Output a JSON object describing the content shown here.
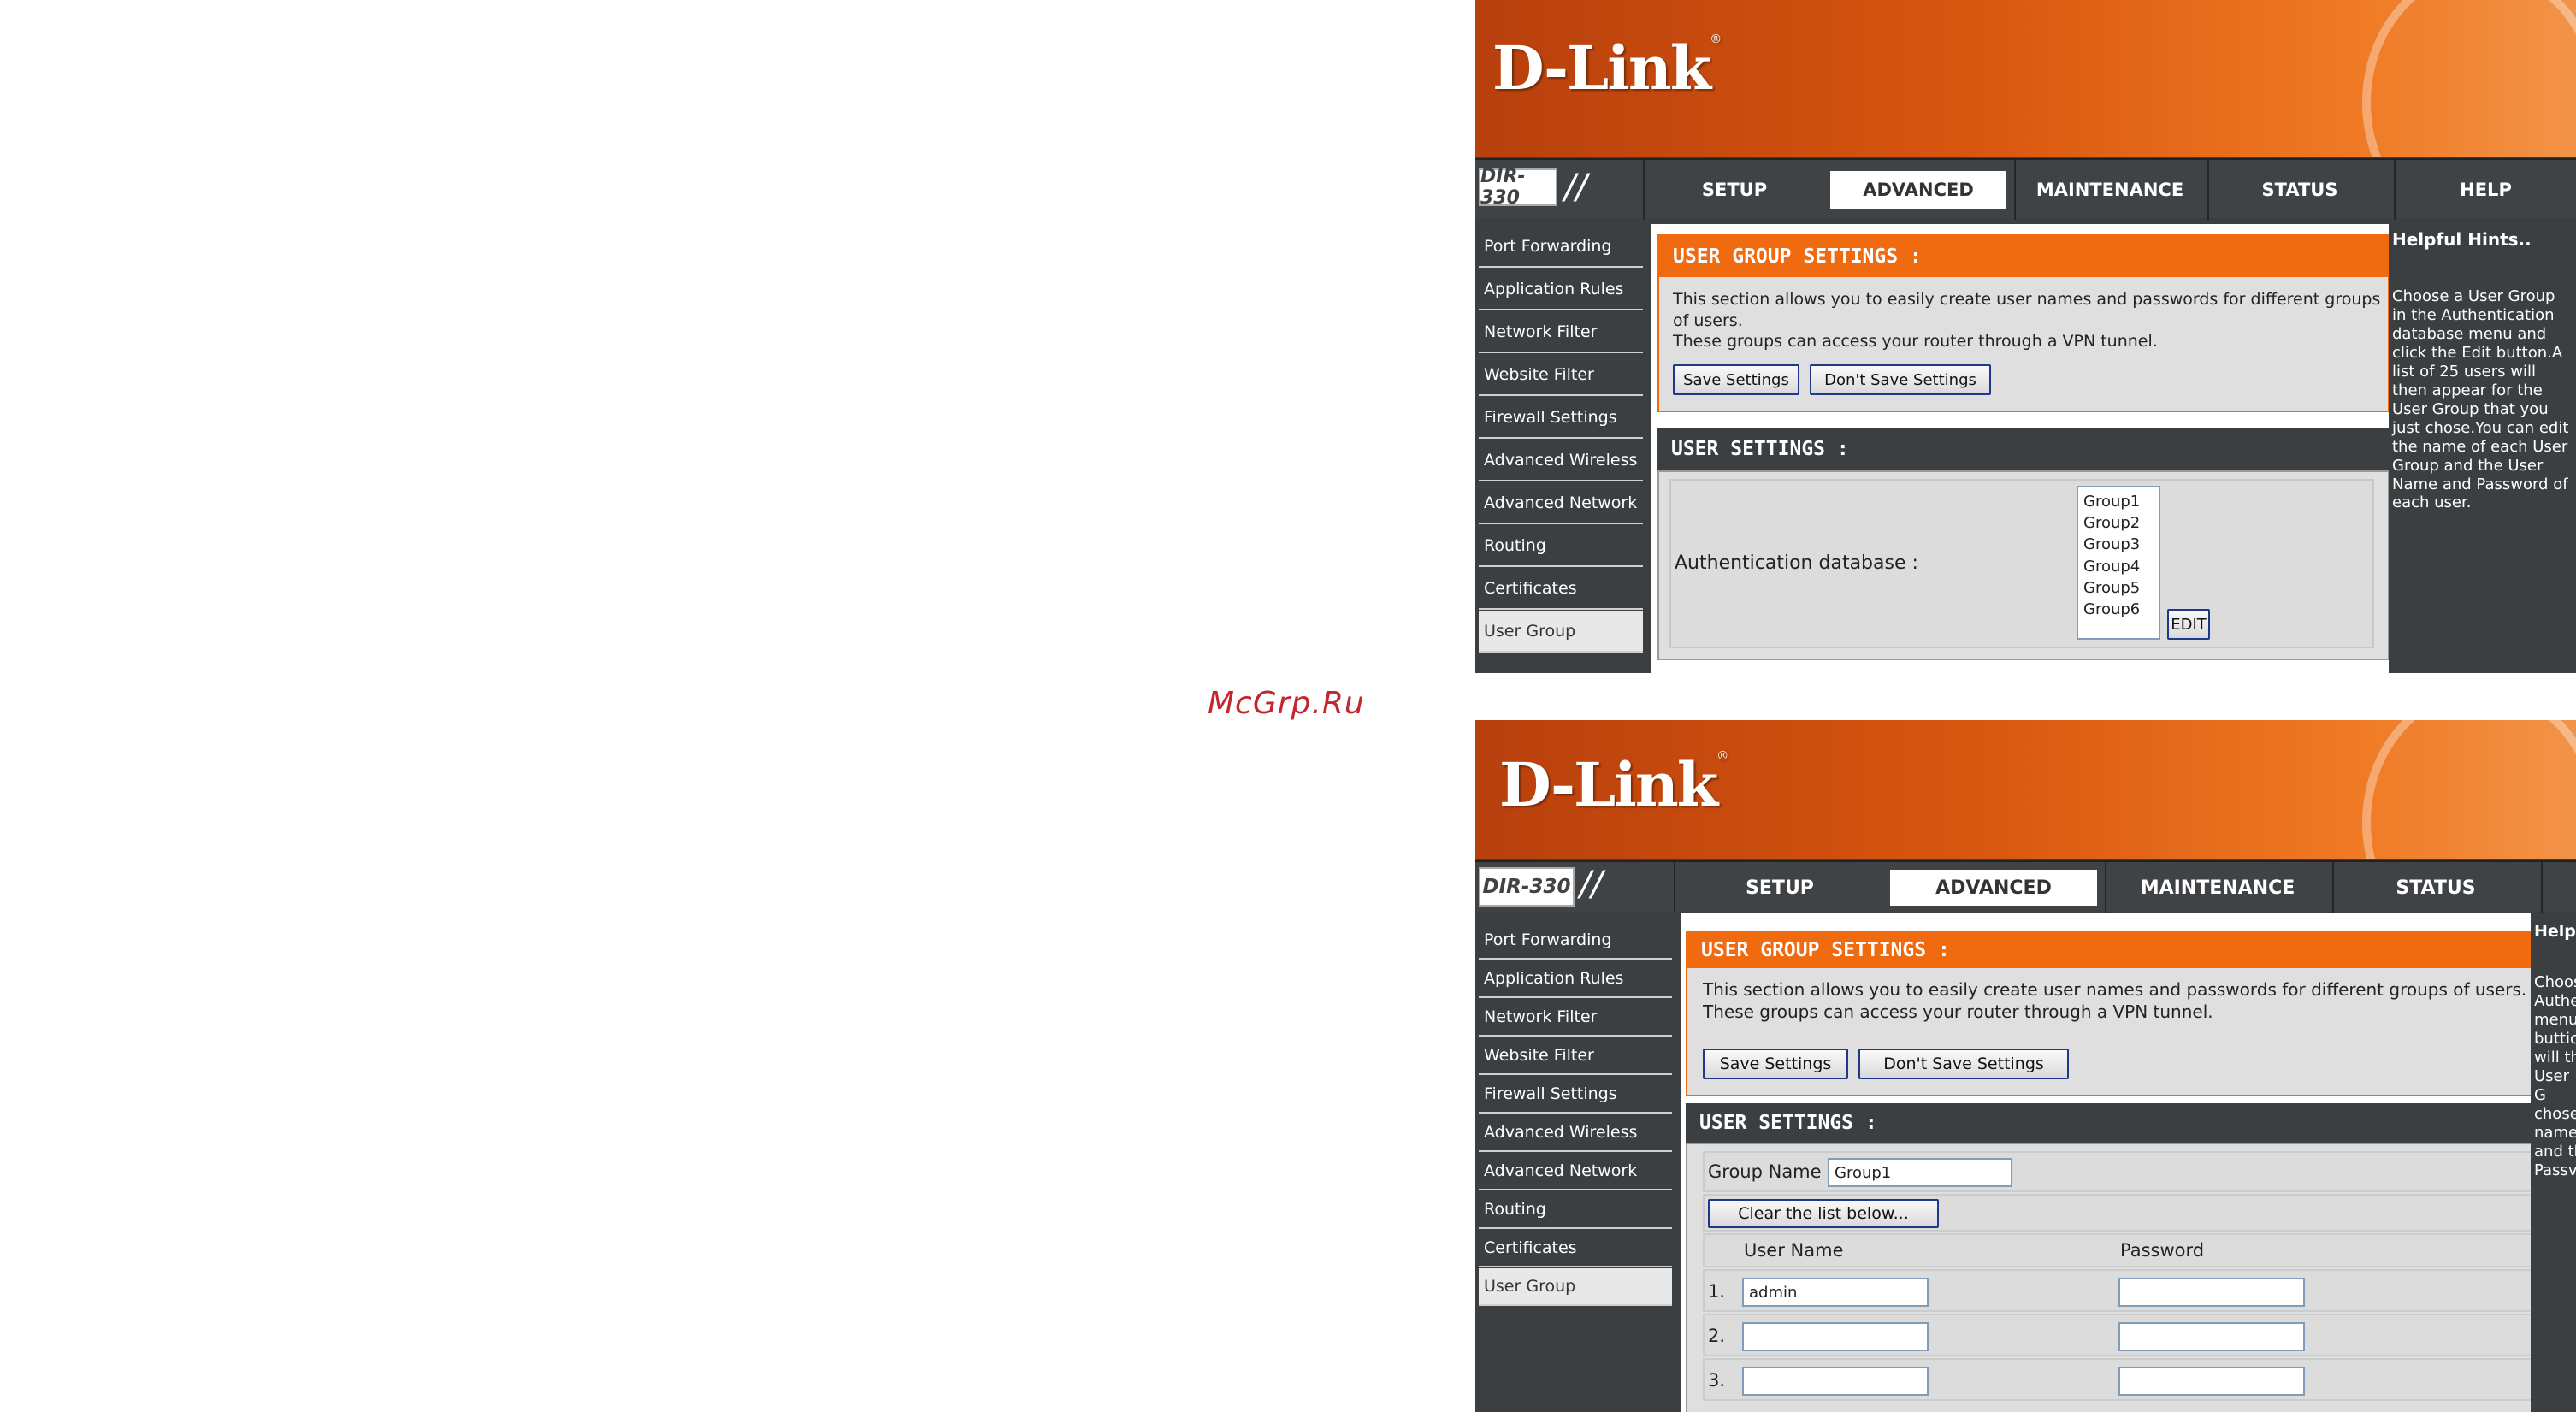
{
  "watermark": "McGrp.Ru",
  "screens": [
    {
      "logo": "D-Link",
      "model": "DIR-330",
      "tabs": [
        "SETUP",
        "ADVANCED",
        "MAINTENANCE",
        "STATUS",
        "HELP"
      ],
      "active_tab": "ADVANCED",
      "sidebar": [
        "Port Forwarding",
        "Application Rules",
        "Network Filter",
        "Website Filter",
        "Firewall Settings",
        "Advanced Wireless",
        "Advanced Network",
        "Routing",
        "Certificates",
        "User Group"
      ],
      "active_sidebar": "User Group",
      "group_section": {
        "title": "USER GROUP SETTINGS :",
        "line1": "This section allows you to easily create user names and passwords for different groups of users.",
        "line2": "These groups can access your router through a VPN tunnel.",
        "save_label": "Save Settings",
        "dont_save_label": "Don't Save Settings"
      },
      "user_section": {
        "title": "USER SETTINGS :",
        "auth_label": "Authentication database :",
        "groups": [
          "Group1",
          "Group2",
          "Group3",
          "Group4",
          "Group5",
          "Group6"
        ],
        "edit_label": "EDIT"
      },
      "hints": {
        "title": "Helpful Hints..",
        "body": "Choose a User Group in the Authentication database menu and click the Edit button.A list of 25 users will then appear for the User Group that you just chose.You can edit the name of each User Group and the User Name and Password of each user."
      }
    },
    {
      "logo": "D-Link",
      "model": "DIR-330",
      "tabs": [
        "SETUP",
        "ADVANCED",
        "MAINTENANCE",
        "STATUS"
      ],
      "active_tab": "ADVANCED",
      "sidebar": [
        "Port Forwarding",
        "Application Rules",
        "Network Filter",
        "Website Filter",
        "Firewall Settings",
        "Advanced Wireless",
        "Advanced Network",
        "Routing",
        "Certificates",
        "User Group"
      ],
      "active_sidebar": "User Group",
      "group_section": {
        "title": "USER GROUP SETTINGS :",
        "line1": "This section allows you to easily create user names and passwords for different groups of users.",
        "line2": "These groups can access your router through a VPN tunnel.",
        "save_label": "Save Settings",
        "dont_save_label": "Don't Save Settings"
      },
      "user_section": {
        "title": "USER SETTINGS :",
        "group_name_label": "Group Name :",
        "group_name_value": "Group1",
        "clear_label": "Clear the list below...",
        "col_user": "User Name",
        "col_password": "Password",
        "rows": [
          {
            "num": "1.",
            "user": "admin",
            "password": ""
          },
          {
            "num": "2.",
            "user": "",
            "password": ""
          },
          {
            "num": "3.",
            "user": "",
            "password": ""
          }
        ]
      },
      "hints": {
        "title": "Help",
        "body_fragments": [
          "Choos",
          "Authe",
          "menu",
          "buttic",
          "will th",
          "User G",
          "chose",
          "name",
          "and th",
          "Passv"
        ]
      }
    }
  ]
}
